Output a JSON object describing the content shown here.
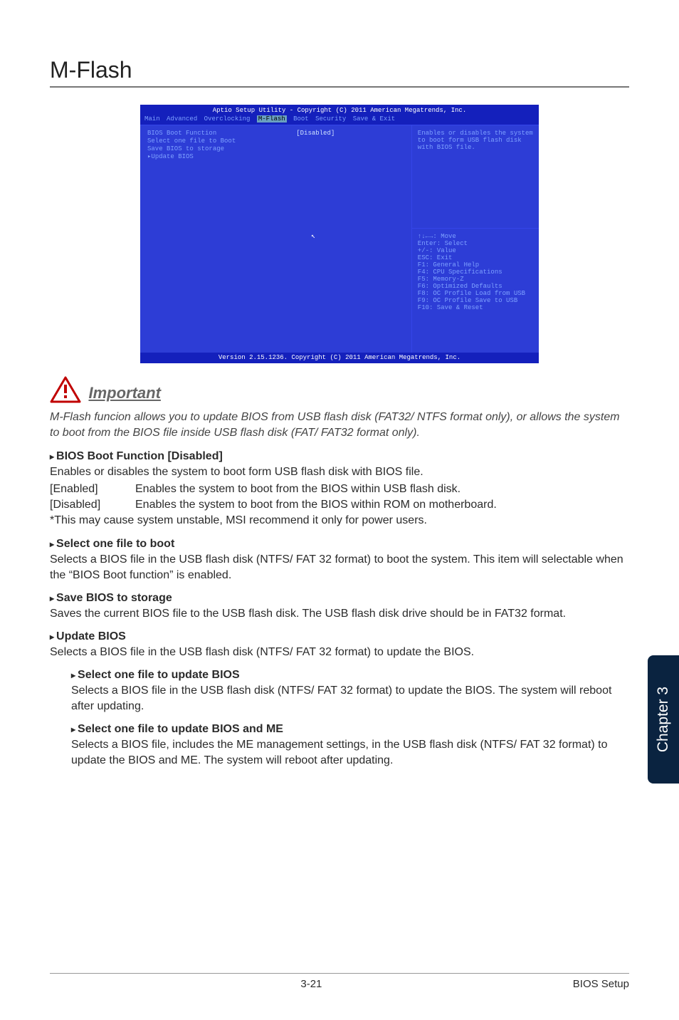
{
  "page": {
    "title": "M-Flash",
    "side_tab": "Chapter 3",
    "footer_page": "3-21",
    "footer_section": "BIOS Setup"
  },
  "bios": {
    "title": "Aptio Setup Utility - Copyright (C) 2011 American Megatrends, Inc.",
    "menu": {
      "items": [
        "Main",
        "Advanced",
        "Overclocking",
        "M-Flash",
        "Boot",
        "Security",
        "Save & Exit"
      ],
      "active": "M-Flash"
    },
    "rows": [
      {
        "key": "BIOS Boot Function",
        "val": "[Disabled]"
      },
      {
        "key": "Select one file to Boot",
        "val": ""
      },
      {
        "key": "Save BIOS to storage",
        "val": ""
      },
      {
        "key": "Update BIOS",
        "val": "",
        "submenu": true
      }
    ],
    "help_top": "Enables or disables the system to boot form USB flash disk with BIOS file.",
    "help_bottom": "↑↓←→: Move\nEnter: Select\n+/-: Value\nESC: Exit\nF1: General Help\nF4: CPU Specifications\nF5: Memory-Z\nF6: Optimized Defaults\nF8: OC Profile Load from USB\nF9: OC Profile Save to USB\nF10: Save & Reset",
    "version": "Version 2.15.1236. Copyright (C) 2011 American Megatrends, Inc."
  },
  "important": {
    "label": "Important",
    "note": "M-Flash funcion allows you to update BIOS from USB flash disk (FAT32/ NTFS format only), or allows the system to boot from the BIOS file inside USB flash disk (FAT/ FAT32 format only)."
  },
  "items": [
    {
      "heading": "BIOS Boot Function [Disabled]",
      "desc": "Enables or disables the system to boot form USB flash disk with BIOS file.",
      "options": [
        {
          "label": "[Enabled]",
          "text": "Enables the system to boot from the BIOS within USB flash disk."
        },
        {
          "label": "[Disabled]",
          "text": "Enables the system to boot from the BIOS within ROM on motherboard."
        }
      ],
      "note": "*This may cause system unstable, MSI recommend it only for power users."
    },
    {
      "heading": "Select one file to boot",
      "desc": "Selects a BIOS file in the USB flash disk (NTFS/ FAT 32 format) to boot the system. This item will selectable when the “BIOS Boot function” is enabled."
    },
    {
      "heading": "Save BIOS to storage",
      "desc": "Saves the current BIOS file to the USB flash disk. The USB flash disk drive should be in FAT32 format."
    },
    {
      "heading": "Update BIOS",
      "desc": "Selects a BIOS file in the USB flash disk (NTFS/ FAT 32 format) to update the BIOS.",
      "subitems": [
        {
          "heading": "Select one file to update BIOS",
          "desc": "Selects a BIOS file in the USB flash disk (NTFS/ FAT 32 format) to update the BIOS. The system will reboot after updating."
        },
        {
          "heading": "Select one file to update BIOS and ME",
          "desc": "Selects a BIOS file, includes the ME management settings, in the USB flash disk (NTFS/ FAT 32 format) to update the BIOS and ME. The system will reboot after updating."
        }
      ]
    }
  ]
}
